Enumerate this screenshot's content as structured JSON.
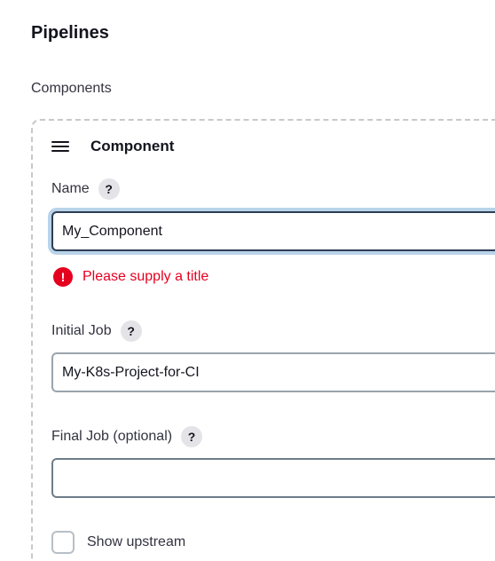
{
  "section": {
    "title": "Pipelines"
  },
  "components": {
    "label": "Components",
    "card": {
      "title": "Component",
      "drag_icon": "hamburger-drag-icon",
      "fields": {
        "name": {
          "label": "Name",
          "value": "My_Component",
          "error": "Please supply a title"
        },
        "initial_job": {
          "label": "Initial Job",
          "value": "My-K8s-Project-for-CI"
        },
        "final_job": {
          "label": "Final Job (optional)",
          "value": ""
        }
      },
      "show_upstream": {
        "label": "Show upstream",
        "checked": false
      }
    }
  },
  "icons": {
    "help_glyph": "?",
    "error_glyph": "!"
  },
  "colors": {
    "error": "#e6001f",
    "focus_ring": "#b9d3ea",
    "help_bg": "#e4e4e8"
  }
}
